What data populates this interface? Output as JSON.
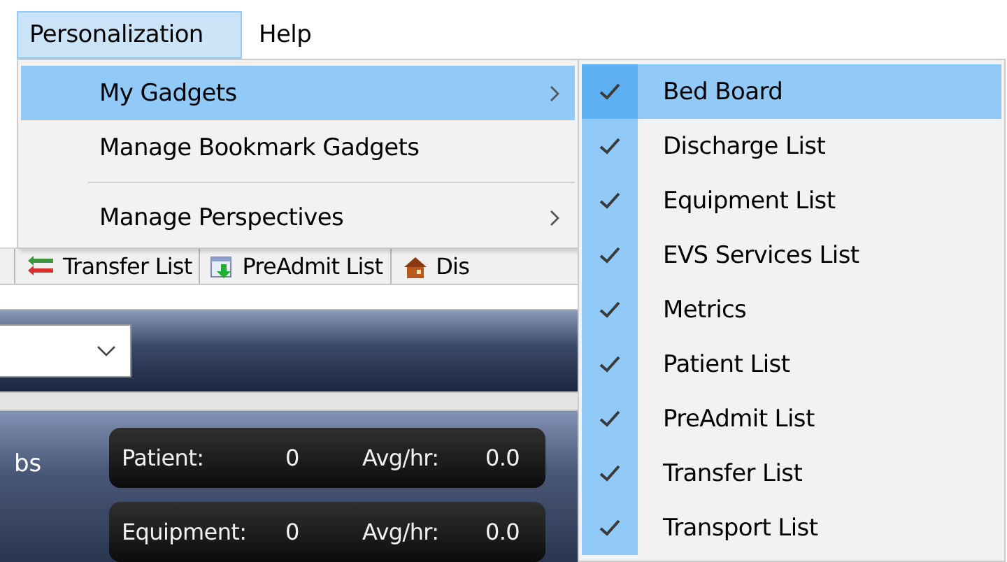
{
  "menu_bar": [
    {
      "label": "Personalization",
      "selected": true
    },
    {
      "label": "Help",
      "selected": false
    }
  ],
  "toolbar": {
    "tabs": [
      {
        "label": "Transfer List"
      },
      {
        "label": "PreAdmit List"
      },
      {
        "label": "Dis"
      }
    ]
  },
  "dashboard": {
    "side_label": "bs",
    "stats": [
      {
        "label": "Patient:",
        "count": "0",
        "avg_label": "Avg/hr:",
        "avg": "0.0"
      },
      {
        "label": "Equipment:",
        "count": "0",
        "avg_label": "Avg/hr:",
        "avg": "0.0"
      }
    ]
  },
  "menu": {
    "items": [
      {
        "kind": "item",
        "label": "My Gadgets",
        "selected": true,
        "has_submenu": true
      },
      {
        "kind": "item",
        "label": "Manage Bookmark Gadgets",
        "selected": false,
        "has_submenu": false
      },
      {
        "kind": "separator"
      },
      {
        "kind": "item",
        "label": "Manage Perspectives",
        "selected": false,
        "has_submenu": true
      }
    ]
  },
  "submenu": {
    "items": [
      {
        "label": "Bed Board",
        "checked": true,
        "selected": true
      },
      {
        "label": "Discharge List",
        "checked": true,
        "selected": false
      },
      {
        "label": "Equipment List",
        "checked": true,
        "selected": false
      },
      {
        "label": "EVS Services List",
        "checked": true,
        "selected": false
      },
      {
        "label": "Metrics",
        "checked": true,
        "selected": false
      },
      {
        "label": "Patient List",
        "checked": true,
        "selected": false
      },
      {
        "label": "PreAdmit List",
        "checked": true,
        "selected": false
      },
      {
        "label": "Transfer List",
        "checked": true,
        "selected": false
      },
      {
        "label": "Transport List",
        "checked": true,
        "selected": false
      }
    ]
  }
}
